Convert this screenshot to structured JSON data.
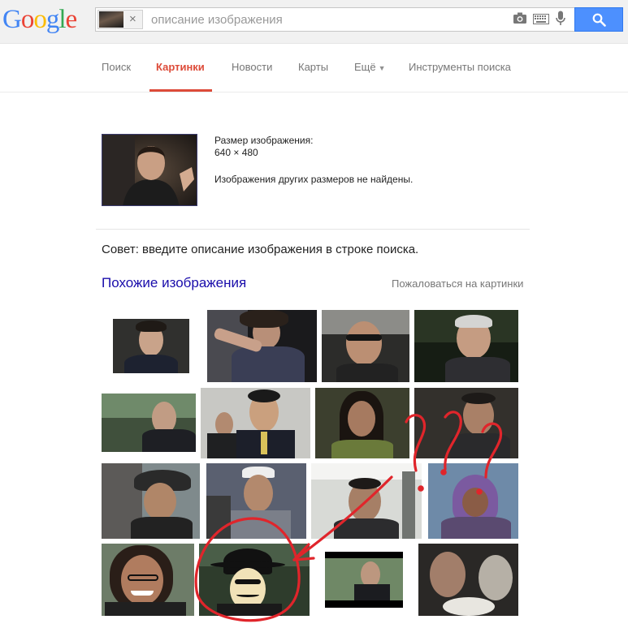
{
  "header": {
    "logo": [
      "G",
      "o",
      "o",
      "g",
      "l",
      "e"
    ],
    "logo_colors": [
      "#4285f4",
      "#ea4335",
      "#fbbc05",
      "#4285f4",
      "#34a853",
      "#ea4335"
    ],
    "search_placeholder": "описание изображения",
    "chip_clear": "×",
    "icons": [
      "camera-icon",
      "keyboard-icon",
      "microphone-icon",
      "search-icon"
    ]
  },
  "nav": {
    "items": [
      "Поиск",
      "Картинки",
      "Новости",
      "Карты",
      "Ещё",
      "Инструменты поиска"
    ],
    "active": "Картинки"
  },
  "info": {
    "size_label": "Размер изображения:",
    "size_value": "640 × 480",
    "no_other_sizes": "Изображения других размеров не найдены."
  },
  "tip": "Совет: введите описание изображения в строке поиска.",
  "similar": {
    "title": "Похожие изображения",
    "report_link": "Пожаловаться на картинки"
  },
  "annotations": {
    "marks": "?",
    "color": "#e0252b"
  },
  "colors": {
    "accent_red": "#dd4b39",
    "link_blue": "#1a0dab",
    "search_blue": "#4d90fe"
  }
}
